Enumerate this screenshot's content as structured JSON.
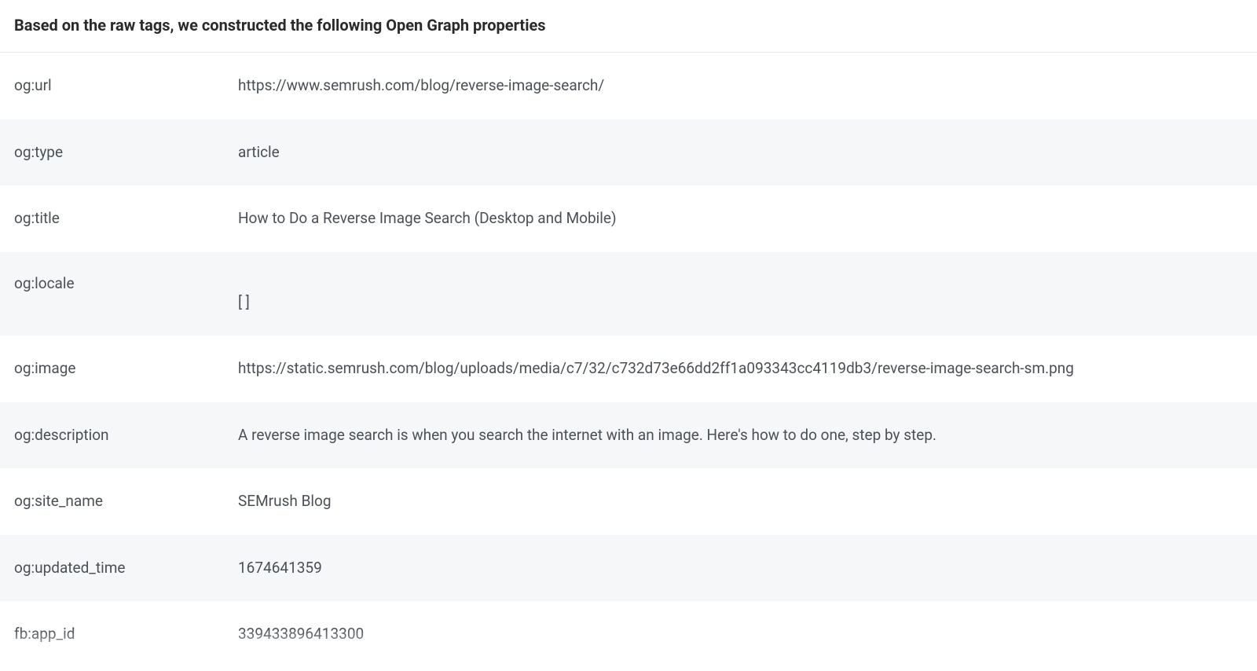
{
  "heading": "Based on the raw tags, we constructed the following Open Graph properties",
  "rows": [
    {
      "key": "og:url",
      "value": "https://www.semrush.com/blog/reverse-image-search/"
    },
    {
      "key": "og:type",
      "value": "article"
    },
    {
      "key": "og:title",
      "value": "How to Do a Reverse Image Search (Desktop and Mobile)"
    },
    {
      "key": "og:locale",
      "value": "[ ]"
    },
    {
      "key": "og:image",
      "value": "https://static.semrush.com/blog/uploads/media/c7/32/c732d73e66dd2ff1a093343cc4119db3/reverse-image-search-sm.png"
    },
    {
      "key": "og:description",
      "value": "A reverse image search is when you search the internet with an image. Here's how to do one, step by step."
    },
    {
      "key": "og:site_name",
      "value": "SEMrush Blog"
    },
    {
      "key": "og:updated_time",
      "value": "1674641359"
    },
    {
      "key": "fb:app_id",
      "value": "339433896413300"
    }
  ]
}
